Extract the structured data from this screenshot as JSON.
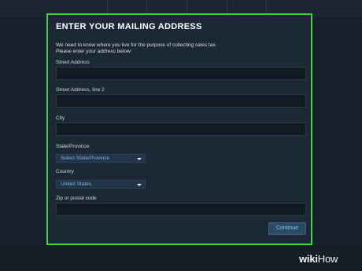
{
  "form": {
    "title": "ENTER YOUR MAILING ADDRESS",
    "intro_line1": "We need to know where you live for the purpose of collecting sales tax.",
    "intro_line2": "Please enter your address below:",
    "street_label": "Street Address",
    "street_value": "",
    "street2_label": "Street Address, line 2",
    "street2_value": "",
    "city_label": "City",
    "city_value": "",
    "state_label": "State/Province",
    "state_value": "Select State/Province",
    "country_label": "Country",
    "country_value": "United States",
    "zip_label": "Zip or postal code",
    "zip_value": "",
    "continue_label": "Continue"
  },
  "watermark": {
    "part1": "wiki",
    "part2": "How"
  },
  "colors": {
    "highlight": "#3fd43a",
    "panel": "#1d2836",
    "link": "#7fb6e6"
  },
  "icons": [
    "chevron-down-icon"
  ]
}
